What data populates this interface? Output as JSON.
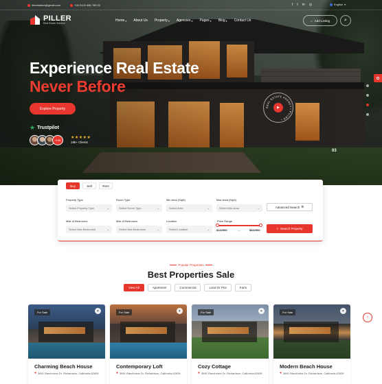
{
  "topbar": {
    "email": "information@gmail.com",
    "phone": "+00 0123 456 789 00",
    "language": "English",
    "social": [
      "facebook-icon",
      "twitter-icon",
      "linkedin-icon",
      "instagram-icon"
    ]
  },
  "logo": {
    "name": "PILLER",
    "tagline": "Real Estate Solution"
  },
  "nav": {
    "items": [
      {
        "label": "Home",
        "dropdown": true
      },
      {
        "label": "About Us",
        "dropdown": false
      },
      {
        "label": "Property",
        "dropdown": true
      },
      {
        "label": "Agencies",
        "dropdown": true
      },
      {
        "label": "Pages",
        "dropdown": true
      },
      {
        "label": "Blog",
        "dropdown": true
      },
      {
        "label": "Contact Us",
        "dropdown": false
      }
    ],
    "add_listing": "Add Listing"
  },
  "hero": {
    "title_line1": "Experience Real Estate",
    "title_line2": "Never Before",
    "cta": "Explore Property",
    "trustpilot": "Trustpilot",
    "avatar_plus": "+10K",
    "stars": "★★★★★",
    "clients": "19k+ Clients",
    "badge_text": "REAL ESTATE AGENCY • PILLER •",
    "slide_number": "03",
    "accent": "#e6362d"
  },
  "search": {
    "tabs": [
      {
        "label": "Buy",
        "active": true
      },
      {
        "label": "Sell",
        "active": false
      },
      {
        "label": "Rent",
        "active": false
      }
    ],
    "fields": {
      "property_type": {
        "label": "Property Type",
        "value": "Select Property Type"
      },
      "room_type": {
        "label": "Room Type",
        "value": "Select Room Type"
      },
      "min_area": {
        "label": "Min Area (SqM)",
        "value": "Select Area"
      },
      "max_area": {
        "label": "Max Area (SqM)",
        "value": "Select Max Area"
      },
      "max_bedrooms": {
        "label": "Max of Bedrooms",
        "value": "Select Max Bedrooms"
      },
      "max_bedrooms2": {
        "label": "Max of Bedrooms",
        "value": "Select Max Bedrooms"
      },
      "location": {
        "label": "Location",
        "value": "Select Location"
      }
    },
    "advanced_search": "Advanced Search",
    "price_range_label": "Price Range",
    "price_min": "$122000",
    "price_max": "$822000",
    "search_button": "Search Property"
  },
  "properties": {
    "eyebrow": "Popular Properties",
    "title": "Best Properties Sale",
    "filters": [
      {
        "label": "View All",
        "active": true
      },
      {
        "label": "Apartment",
        "active": false
      },
      {
        "label": "Commercial",
        "active": false
      },
      {
        "label": "Land Or Plot",
        "active": false
      },
      {
        "label": "Farm",
        "active": false
      }
    ],
    "cards": [
      {
        "tag": "For Sale",
        "name": "Charming Beach House",
        "address": "3891 Ranchview Dr. Richardson, California 62639"
      },
      {
        "tag": "For Sale",
        "name": "Contemporary Loft",
        "address": "3891 Ranchview Dr. Richardson, California 62639"
      },
      {
        "tag": "For Sale",
        "name": "Cozy Cottage",
        "address": "3891 Ranchview Dr. Richardson, California 62639"
      },
      {
        "tag": "For Sale",
        "name": "Modern Beach House",
        "address": "3891 Ranchview Dr. Richardson, California 62639"
      }
    ]
  }
}
